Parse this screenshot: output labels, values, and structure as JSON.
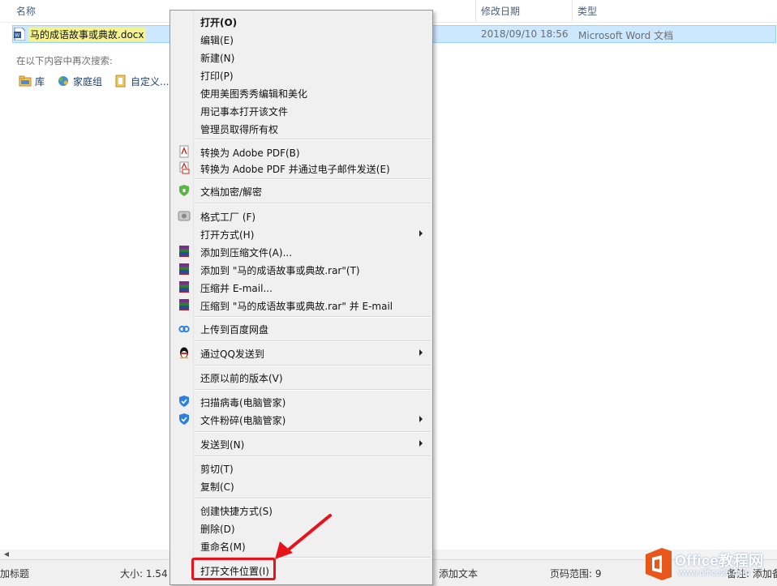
{
  "columns": {
    "name": "名称",
    "modified": "修改日期",
    "type": "类型"
  },
  "file": {
    "name": "马的成语故事或典故",
    "ext": ".docx",
    "modified": "2018/09/10 18:56",
    "type": "Microsoft Word 文档"
  },
  "search_again": {
    "label": "在以下内容中再次搜索:",
    "locations": [
      "库",
      "家庭组",
      "自定义..."
    ]
  },
  "context_menu": {
    "items": [
      {
        "label": "打开(O)"
      },
      {
        "label": "编辑(E)"
      },
      {
        "label": "新建(N)"
      },
      {
        "label": "打印(P)"
      },
      {
        "label": "使用美图秀秀编辑和美化"
      },
      {
        "label": "用记事本打开该文件"
      },
      {
        "label": "管理员取得所有权"
      },
      {
        "label": "转换为 Adobe PDF(B)"
      },
      {
        "label": "转换为 Adobe PDF 并通过电子邮件发送(E)"
      },
      {
        "label": "文档加密/解密"
      },
      {
        "label": "格式工厂 (F)"
      },
      {
        "label": "打开方式(H)"
      },
      {
        "label": "添加到压缩文件(A)..."
      },
      {
        "label": "添加到 \"马的成语故事或典故.rar\"(T)"
      },
      {
        "label": "压缩并 E-mail..."
      },
      {
        "label": "压缩到 \"马的成语故事或典故.rar\" 并 E-mail"
      },
      {
        "label": "上传到百度网盘"
      },
      {
        "label": "通过QQ发送到"
      },
      {
        "label": "还原以前的版本(V)"
      },
      {
        "label": "扫描病毒(电脑管家)"
      },
      {
        "label": "文件粉碎(电脑管家)"
      },
      {
        "label": "发送到(N)"
      },
      {
        "label": "剪切(T)"
      },
      {
        "label": "复制(C)"
      },
      {
        "label": "创建快捷方式(S)"
      },
      {
        "label": "删除(D)"
      },
      {
        "label": "重命名(M)"
      },
      {
        "label": "打开文件位置(I)"
      }
    ]
  },
  "status": {
    "tags": "加标题",
    "size": "大小: 1.54",
    "comments": "添加文本",
    "page_range": "页码范围: 9",
    "notes": "备注: 添加备"
  },
  "watermark": {
    "brand": "Office教程网",
    "url": "www.office26.com"
  },
  "colors": {
    "highlight": "#e8121b",
    "selection": "#cce8ff",
    "name_highlight": "#f5f390"
  }
}
